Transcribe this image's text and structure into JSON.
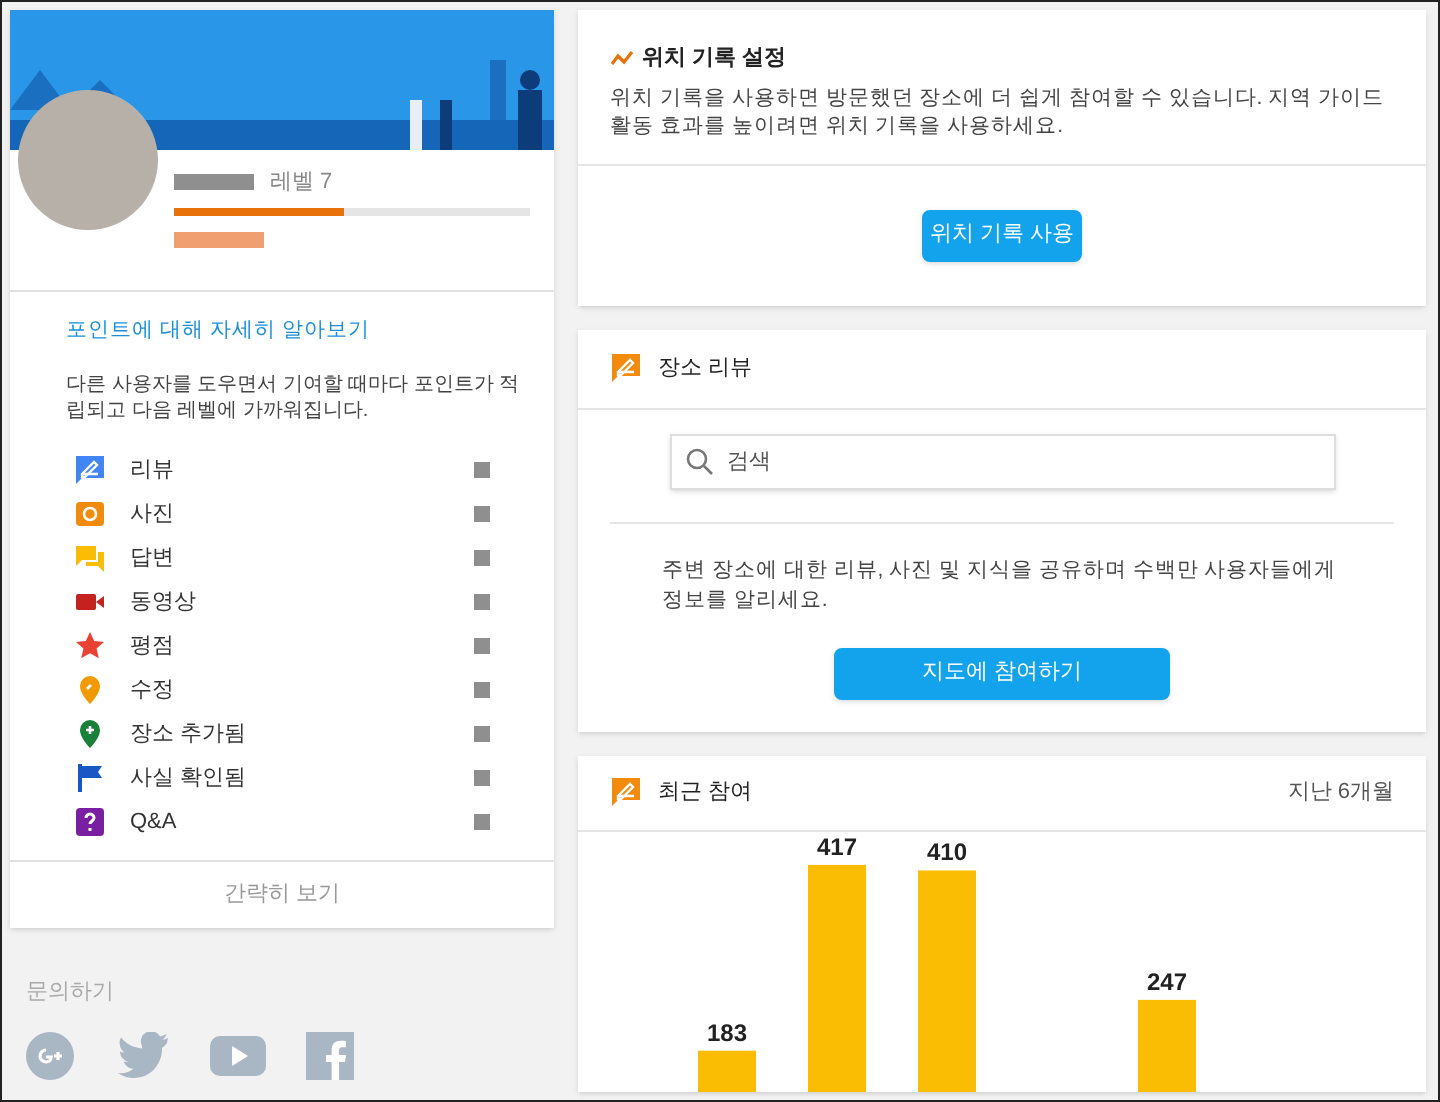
{
  "profile": {
    "level_label": "레벨 7",
    "progress": {
      "level": 0.48
    }
  },
  "points_info": {
    "link": "포인트에 대해 자세히 알아보기",
    "description": "다른 사용자를 도우면서 기여할 때마다 포인트가 적립되고 다음 레벨에 가까워집니다."
  },
  "contributions": [
    {
      "kind": "review",
      "label": "리뷰"
    },
    {
      "kind": "photo",
      "label": "사진"
    },
    {
      "kind": "answer",
      "label": "답변"
    },
    {
      "kind": "video",
      "label": "동영상"
    },
    {
      "kind": "rating",
      "label": "평점"
    },
    {
      "kind": "edit",
      "label": "수정"
    },
    {
      "kind": "place",
      "label": "장소 추가됨"
    },
    {
      "kind": "fact",
      "label": "사실 확인됨"
    },
    {
      "kind": "qa",
      "label": "Q&A"
    }
  ],
  "collapse_link": "간략히 보기",
  "contact": {
    "label": "문의하기"
  },
  "location_history": {
    "title": "위치 기록 설정",
    "description": "위치 기록을 사용하면 방문했던 장소에 더 쉽게 참여할 수 있습니다. 지역 가이드 활동 효과를 높이려면 위치 기록을 사용하세요.",
    "button": "위치 기록 사용"
  },
  "place_reviews": {
    "title": "장소 리뷰",
    "search": {
      "placeholder": "검색"
    },
    "description": "주변 장소에 대한 리뷰, 사진 및 지식을 공유하며 수백만 사용자들에게 정보를 알리세요.",
    "button": "지도에 참여하기"
  },
  "recent": {
    "title": "최근 참여",
    "period": "지난 6개월",
    "bars": [
      {
        "label": "183"
      },
      {
        "label": "417"
      },
      {
        "label": "410"
      },
      {
        "label": "247"
      }
    ]
  }
}
